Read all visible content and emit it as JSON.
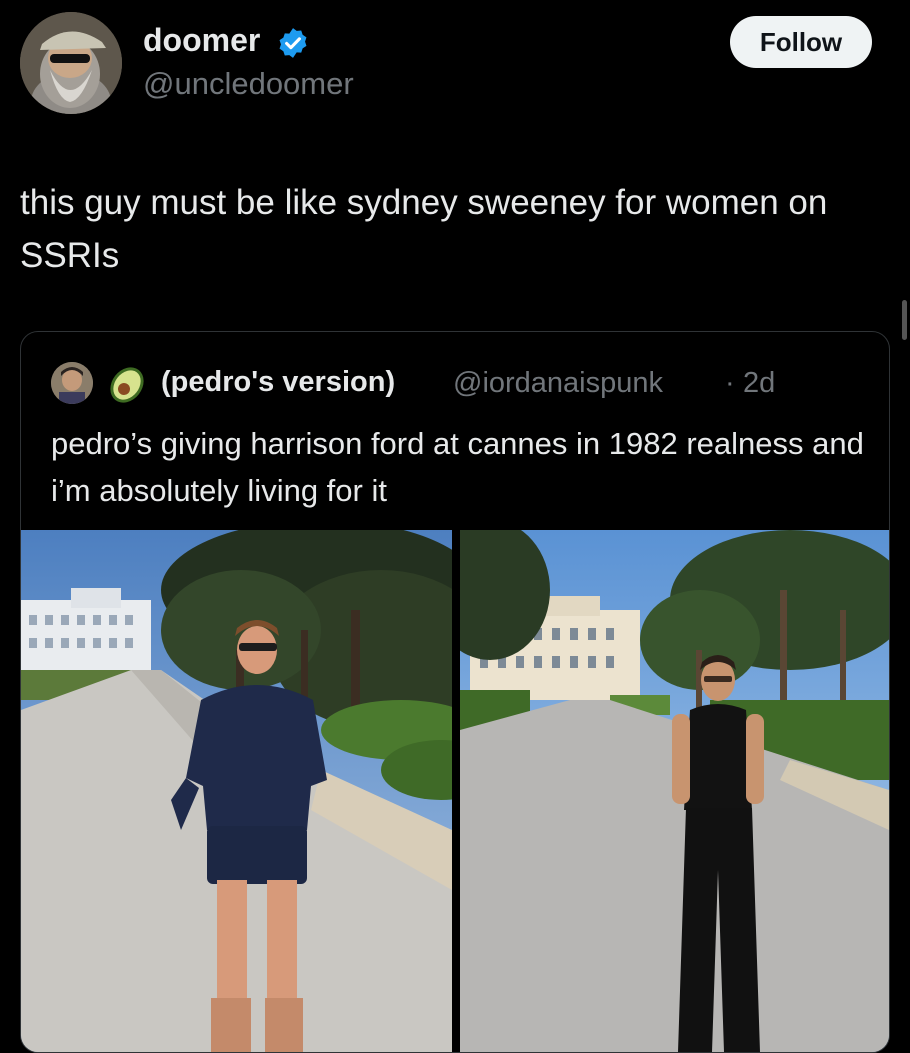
{
  "post": {
    "author": {
      "name": "doomer",
      "handle": "@uncledoomer",
      "verified": true,
      "verified_icon": "verified-badge-icon",
      "avatar": "avatar-bearded-man-cap-sunglasses"
    },
    "follow_label": "Follow",
    "text": "this guy must be like sydney sweeney for women on SSRIs"
  },
  "quote": {
    "name": "(pedro's version)",
    "name_emoji": "avocado-icon",
    "handle": "@iordanaispunk",
    "separator": "·",
    "time": "2d",
    "text": "pedro’s giving harrison ford at cannes in 1982 realness and i’m absolutely living for it",
    "images": [
      {
        "name": "photo-harrison-ford-cannes-1982"
      },
      {
        "name": "photo-pedro-pascal-cannes"
      }
    ]
  },
  "colors": {
    "background": "#000000",
    "text_primary": "#e7e9ea",
    "text_secondary": "#71767b",
    "verified_blue": "#1d9bf0",
    "follow_button_bg": "#eff3f4",
    "border": "#2f3336"
  }
}
